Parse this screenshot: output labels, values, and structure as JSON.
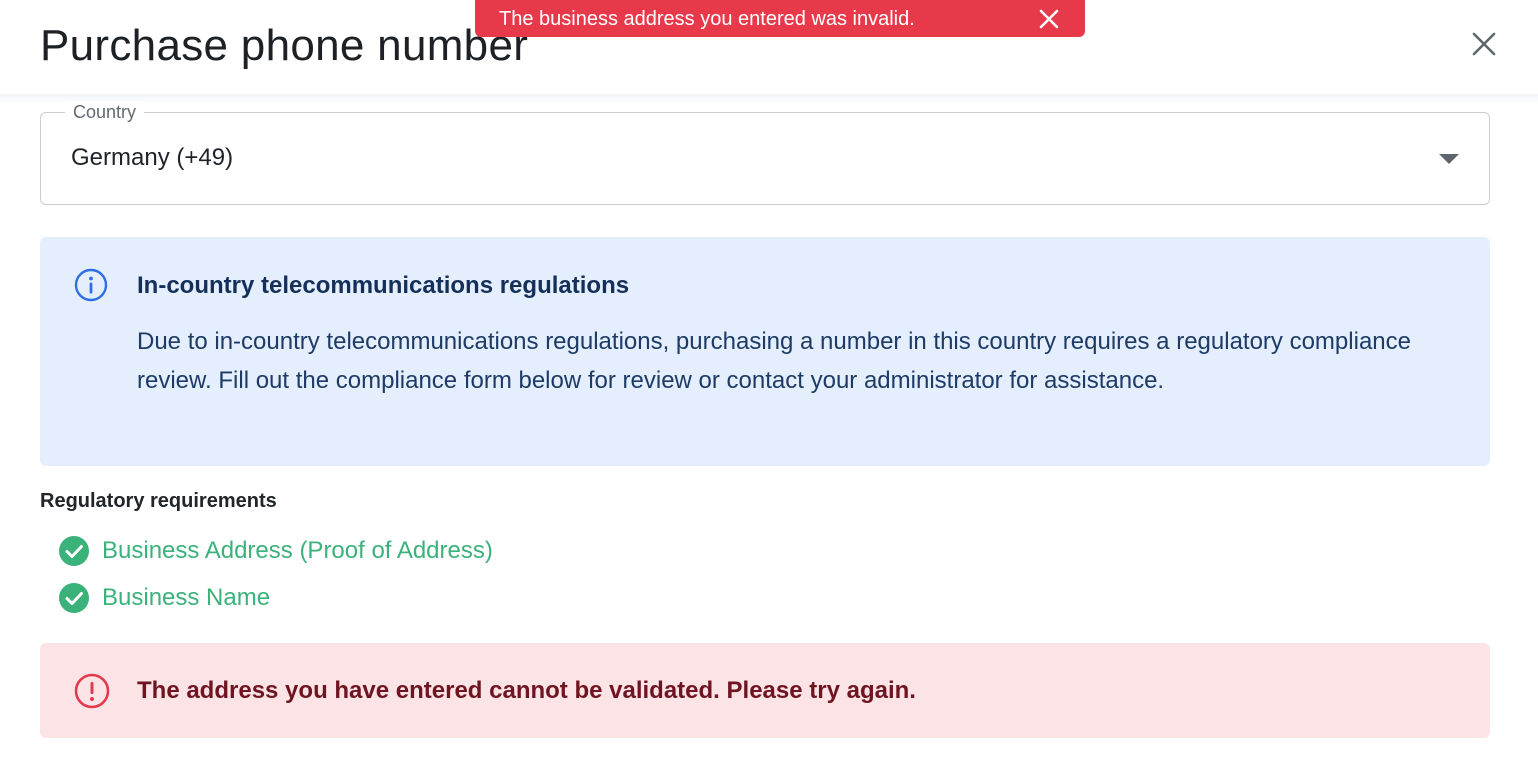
{
  "toast": {
    "message": "The business address you entered was invalid.",
    "icon": "close-icon",
    "color": "#e8394a"
  },
  "dialog": {
    "title": "Purchase phone number",
    "close_icon": "close-icon"
  },
  "country_field": {
    "label": "Country",
    "value": "Germany (+49)",
    "icon": "chevron-down-icon"
  },
  "info_panel": {
    "icon": "info-icon",
    "title": "In-country telecommunications regulations",
    "body": "Due to in-country telecommunications regulations, purchasing a number in this country requires a regulatory compliance review. Fill out the compliance form below for review or contact your administrator for assistance.",
    "background": "#e4eefc"
  },
  "requirements": {
    "label": "Regulatory requirements",
    "items": [
      {
        "label": "Business Address (Proof of Address)",
        "status": "complete",
        "icon": "check-circle-icon"
      },
      {
        "label": "Business Name",
        "status": "complete",
        "icon": "check-circle-icon"
      }
    ],
    "complete_color": "#3bb27a"
  },
  "error_banner": {
    "icon": "alert-circle-icon",
    "message": "The address you have entered cannot be validated. Please try again.",
    "background": "#fbe3e6"
  }
}
